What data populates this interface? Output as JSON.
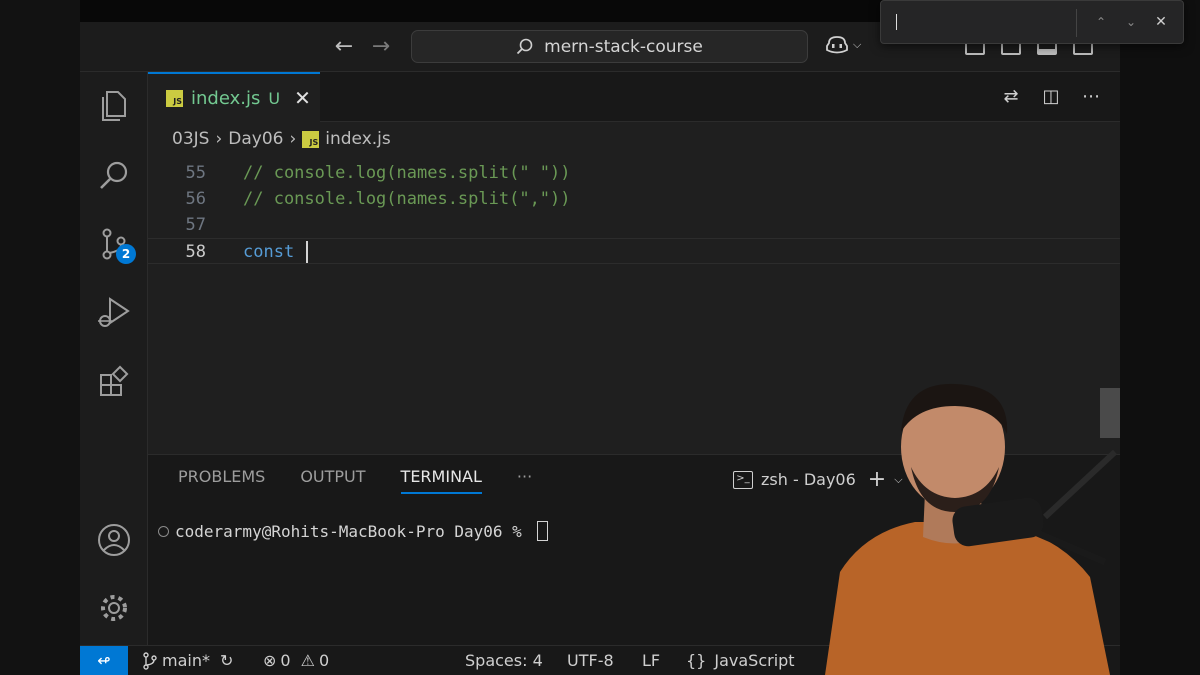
{
  "titlebar": {
    "back_icon": "arrow-left-icon",
    "forward_icon": "arrow-right-icon",
    "search_text": "mern-stack-course",
    "search_icon": "search-icon",
    "copilot_icon": "copilot-icon"
  },
  "find_widget": {
    "value": "",
    "prev_icon": "chevron-up-icon",
    "next_icon": "chevron-down-icon",
    "close_icon": "close-icon"
  },
  "activity_bar": {
    "items": [
      "explorer-icon",
      "search-icon",
      "source-control-icon",
      "run-debug-icon",
      "extensions-icon"
    ],
    "source_control_badge": "2",
    "bottom_items": [
      "account-icon",
      "gear-icon"
    ]
  },
  "tabs": [
    {
      "label": "index.js",
      "status": "U",
      "icon": "javascript-file-icon"
    }
  ],
  "breadcrumb": {
    "items": [
      "03JS",
      "Day06",
      "index.js"
    ]
  },
  "editor": {
    "lines": [
      {
        "number": "55",
        "text": "// console.log(names.split(\" \"))",
        "kind": "comment"
      },
      {
        "number": "56",
        "text": "// console.log(names.split(\",\"))",
        "kind": "comment"
      },
      {
        "number": "57",
        "text": "",
        "kind": "blank"
      },
      {
        "number": "58",
        "text": "const ",
        "kind": "keyword"
      }
    ]
  },
  "panel": {
    "tabs": [
      "PROBLEMS",
      "OUTPUT",
      "TERMINAL"
    ],
    "active_tab": "TERMINAL",
    "more_label": "···",
    "terminal_name": "zsh - Day06",
    "prompt": "coderarmy@Rohits-MacBook-Pro Day06 % "
  },
  "statusbar": {
    "branch": "main*",
    "errors": "0",
    "warnings": "0",
    "spaces": "Spaces: 4",
    "encoding": "UTF-8",
    "eol": "LF",
    "language_icon": "{}",
    "language": "JavaScript"
  },
  "colors": {
    "accent": "#0078d4",
    "comment": "#6a9955",
    "keyword": "#569cd6",
    "untracked": "#73c991"
  }
}
